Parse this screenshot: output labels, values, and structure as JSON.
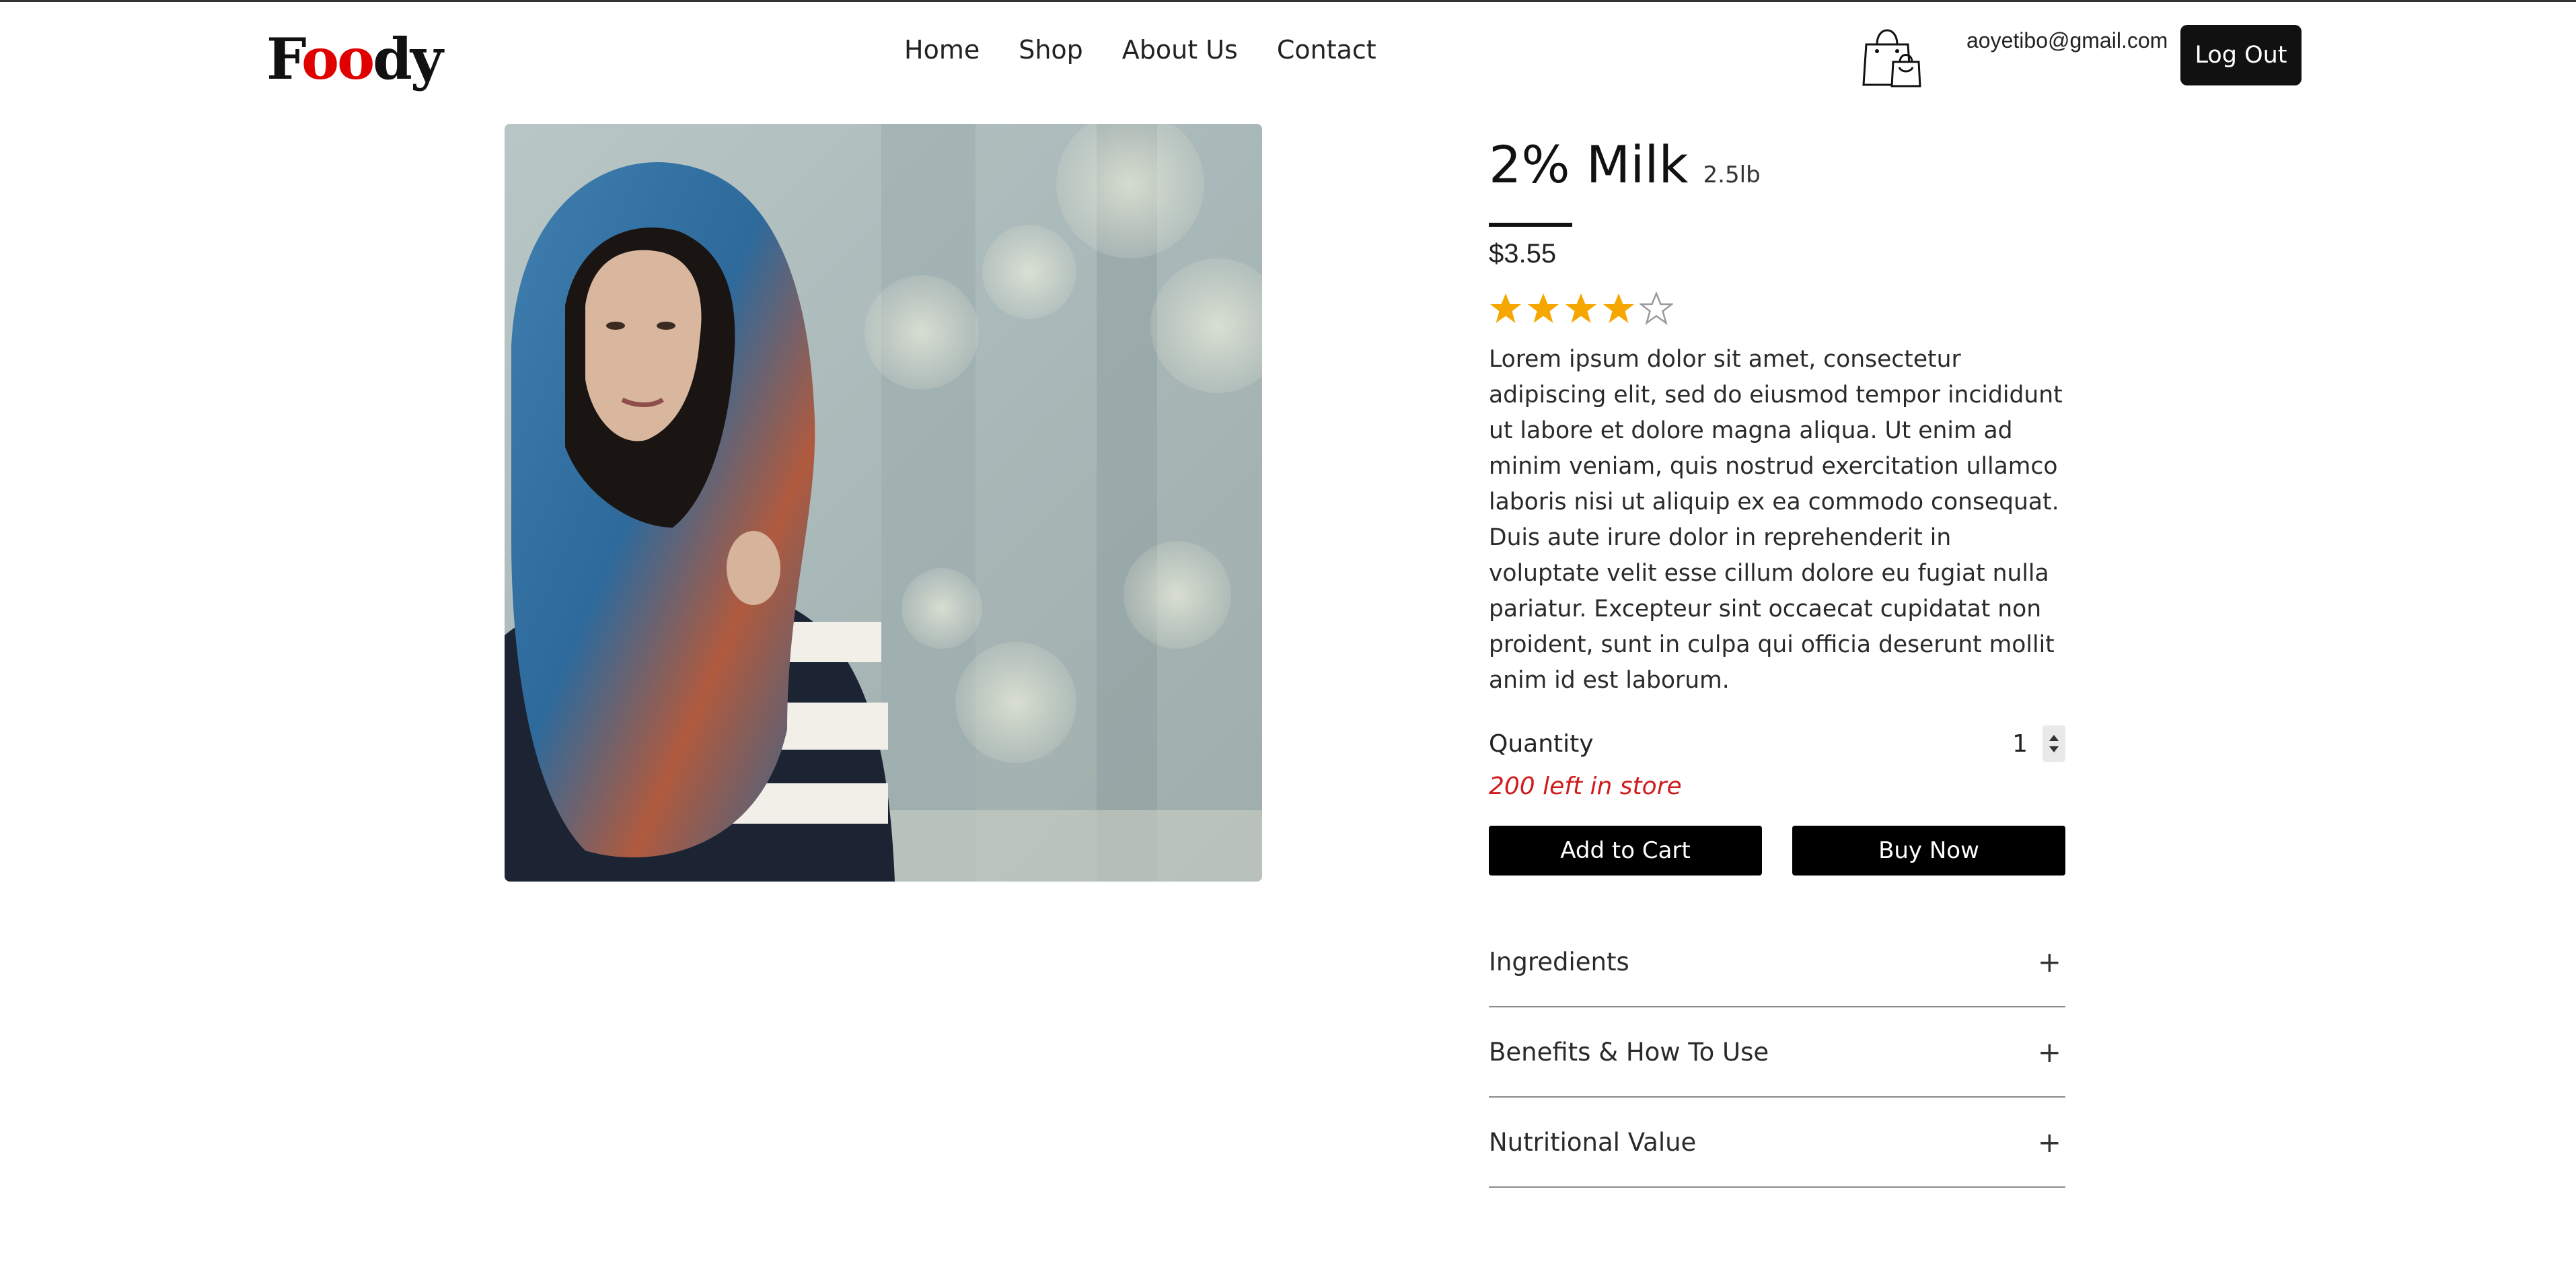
{
  "header": {
    "logo": {
      "part1": "F",
      "part2": "oo",
      "part3": "dy"
    },
    "nav": [
      {
        "label": "Home"
      },
      {
        "label": "Shop"
      },
      {
        "label": "About Us"
      },
      {
        "label": "Contact"
      }
    ],
    "cart_icon": "shopping-bag-icon",
    "user_email": "aoyetibo@gmail.com",
    "logout_label": "Log Out"
  },
  "product": {
    "image_icon": "product-photo",
    "title": "2% Milk",
    "size": "2.5lb",
    "price": "$3.55",
    "rating": 4,
    "rating_max": 5,
    "description": "Lorem ipsum dolor sit amet, consectetur adipiscing elit, sed do eiusmod tempor incididunt ut labore et dolore magna aliqua. Ut enim ad minim veniam, quis nostrud exercitation ullamco laboris nisi ut aliquip ex ea commodo consequat. Duis aute irure dolor in reprehenderit in voluptate velit esse cillum dolore eu fugiat nulla pariatur. Excepteur sint occaecat cupidatat non proident, sunt in culpa qui officia deserunt mollit anim id est laborum.",
    "quantity_label": "Quantity",
    "quantity_value": "1",
    "stock_text": "200 left in store",
    "add_to_cart_label": "Add to Cart",
    "buy_now_label": "Buy Now"
  },
  "accordion": [
    {
      "label": "Ingredients",
      "icon": "+"
    },
    {
      "label": "Benefits & How To Use",
      "icon": "+"
    },
    {
      "label": "Nutritional Value",
      "icon": "+"
    }
  ],
  "colors": {
    "accent": "#000000",
    "logo_red": "#e00000",
    "stock_red": "#d01b1b",
    "star_filled": "#f5a700",
    "star_empty": "#9a9a9a"
  }
}
